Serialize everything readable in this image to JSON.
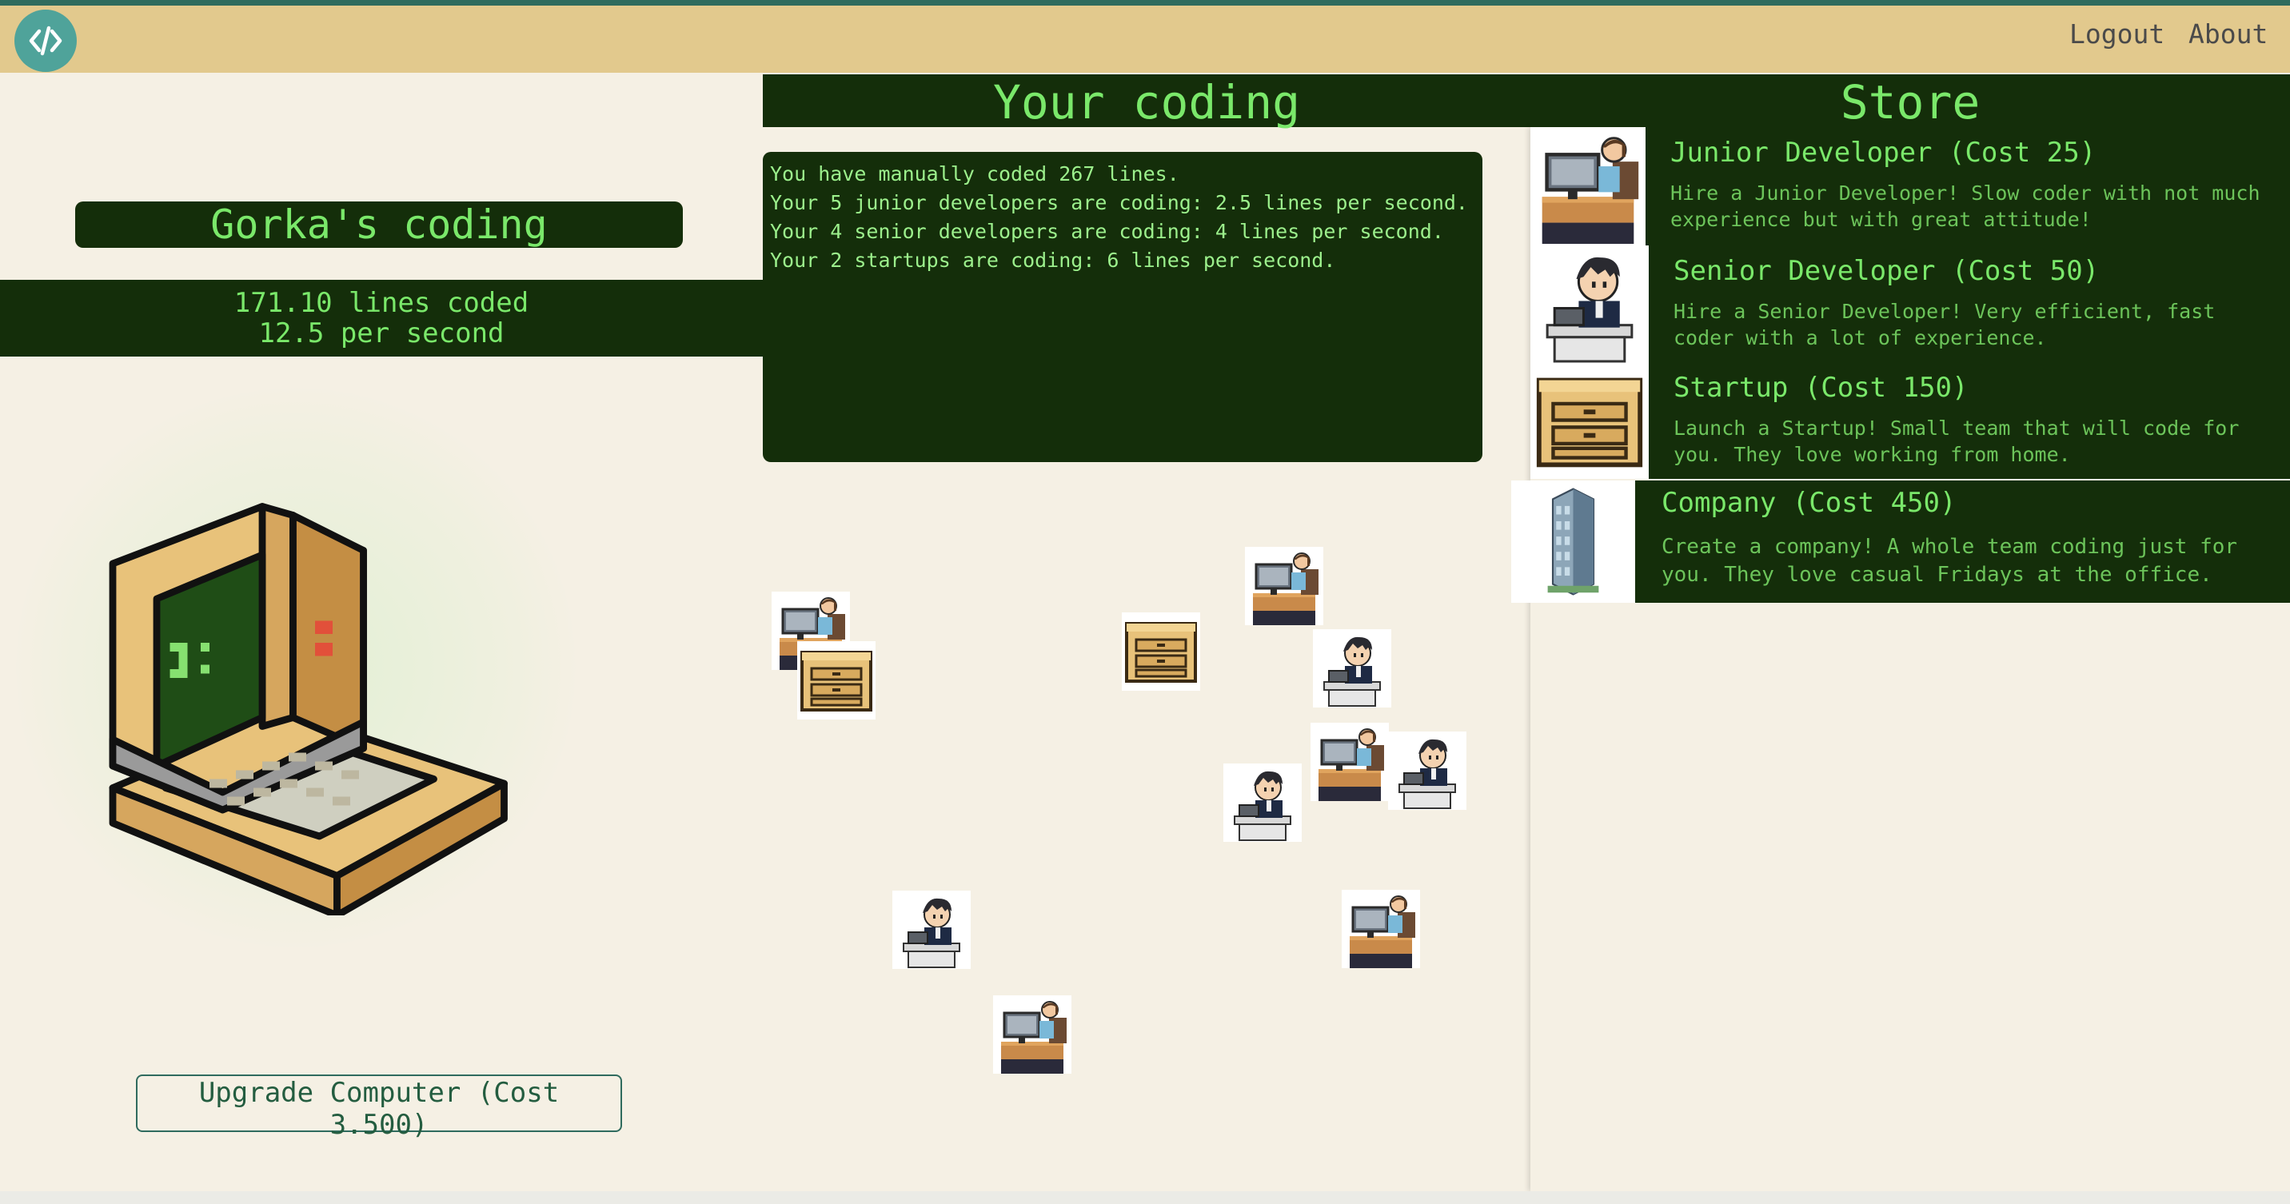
{
  "navbar": {
    "logo_icon": "code-brackets-icon",
    "logout_label": "Logout",
    "about_label": "About"
  },
  "player": {
    "title": "Gorka's coding",
    "lines_coded": "171.10 lines coded",
    "per_second": "12.5 per second",
    "upgrade_label": "Upgrade Computer (Cost 3.500)"
  },
  "coding": {
    "title": "Your coding",
    "log": [
      "You have manually coded 267 lines.",
      "Your 5 junior developers are coding: 2.5 lines per second.",
      "Your 4 senior developers are coding: 4 lines per second.",
      "Your 2 startups are coding: 6 lines per second."
    ]
  },
  "store": {
    "title": "Store",
    "items": [
      {
        "name": "Junior Developer (Cost 25)",
        "desc": "Hire a Junior Developer! Slow coder with not much experience but with great attitude!",
        "icon": "junior-developer-icon"
      },
      {
        "name": "Senior Developer (Cost 50)",
        "desc": "Hire a Senior Developer! Very efficient, fast coder with a lot of experience.",
        "icon": "senior-developer-icon"
      },
      {
        "name": "Startup (Cost 150)",
        "desc": "Launch a Startup! Small team that will code for you. They love working from home.",
        "icon": "startup-icon"
      },
      {
        "name": "Company (Cost 450)",
        "desc": "Create a company! A whole team coding just for you. They love casual Fridays at the office.",
        "icon": "company-building-icon"
      }
    ]
  },
  "colors": {
    "dark_panel": "#142e0a",
    "text_green": "#7ae86a",
    "navbar": "#e2c98d",
    "background": "#f5f0e4",
    "accent_teal": "#2f6b5e"
  }
}
